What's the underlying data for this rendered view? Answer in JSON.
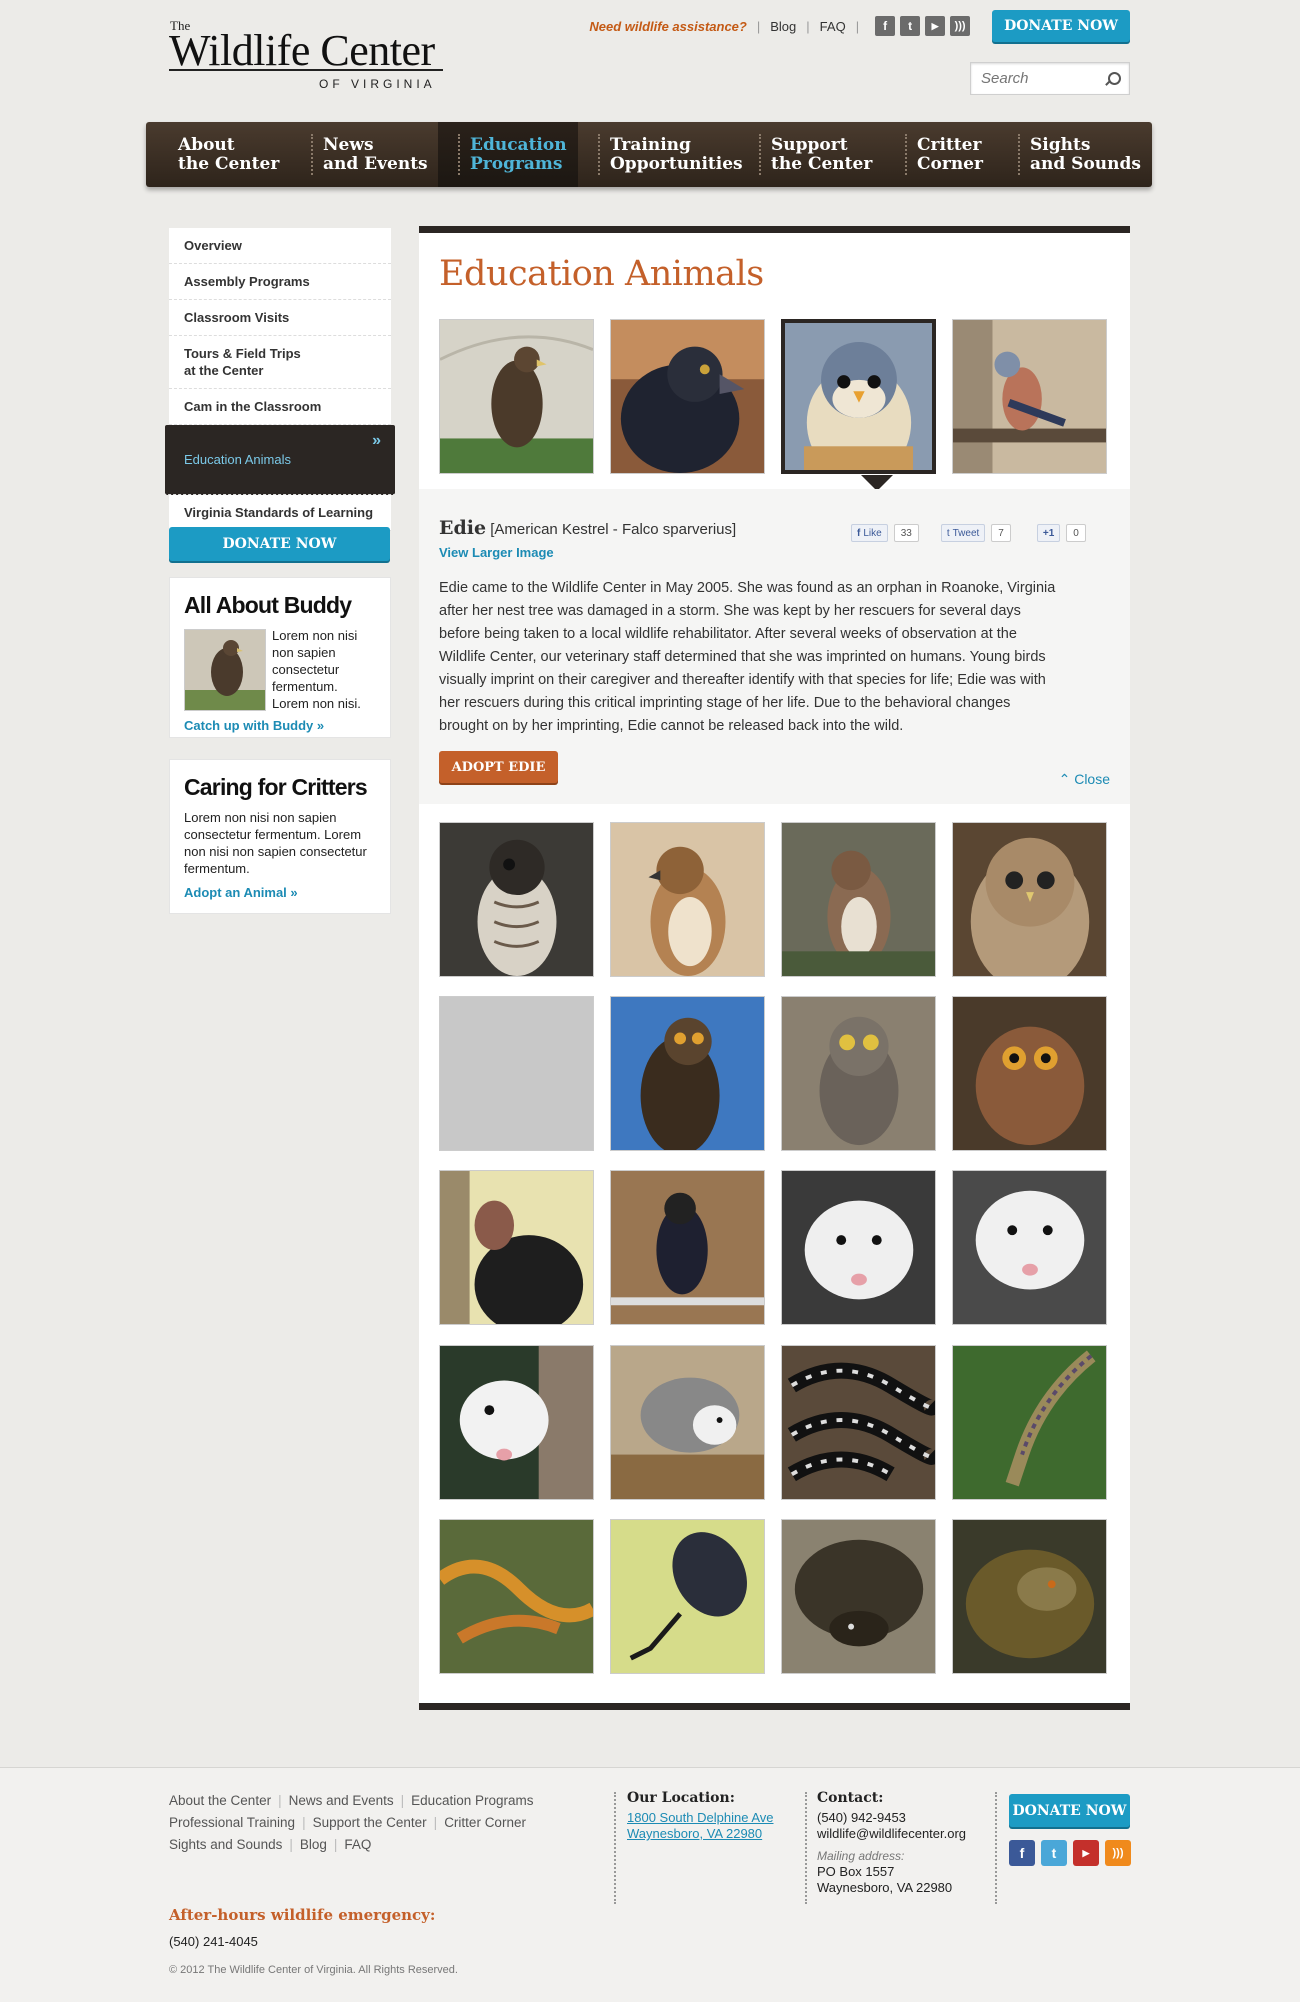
{
  "site": {
    "logo_the": "The",
    "logo_name": "Wildlife Center",
    "logo_sub": "OF VIRGINIA"
  },
  "topbar": {
    "assist": "Need wildlife assistance?",
    "blog": "Blog",
    "faq": "FAQ",
    "donate": "DONATE NOW"
  },
  "search": {
    "placeholder": "Search"
  },
  "nav": [
    "About\nthe Center",
    "News\nand Events",
    "Education\nPrograms",
    "Training\nOpportunities",
    "Support\nthe Center",
    "Critter\nCorner",
    "Sights\nand Sounds"
  ],
  "sidenav": [
    "Overview",
    "Assembly Programs",
    "Classroom Visits",
    "Tours & Field Trips\nat the Center",
    "Cam in the Classroom",
    "Education Animals",
    "Virginia Standards of Learning"
  ],
  "sidebar": {
    "donate": "DONATE NOW",
    "buddy_title": "All About Buddy",
    "buddy_text": "Lorem non nisi non sapien consectetur fermentum. Lorem non nisi.",
    "buddy_link": "Catch up with Buddy »",
    "critters_title": "Caring for Critters",
    "critters_text": "Lorem non nisi non sapien consectetur fermentum. Lorem non nisi non sapien consectetur fermentum.",
    "critters_link": "Adopt an Animal »"
  },
  "content": {
    "title": "Education Animals",
    "animal_name": "Edie",
    "animal_species": "[American Kestrel - Falco sparverius]",
    "view_larger": "View Larger Image",
    "like": "Like",
    "like_count": "33",
    "tweet": "Tweet",
    "tweet_count": "7",
    "plus": "+1",
    "plus_count": "0",
    "description": "Edie came to the Wildlife Center in May 2005. She was found as an orphan in Roanoke, Virginia after her nest tree was damaged in a storm. She was kept by her rescuers for several days before being taken to a local wildlife rehabilitator. After several weeks of observation at the Wildlife Center, our veterinary staff determined that she was imprinted on humans. Young birds visually imprint on their caregiver and thereafter identify with that species for life; Edie was with her rescuers during this critical imprinting stage of her life. Due to the behavioral changes brought on by her imprinting, Edie cannot be released back into the wild.",
    "adopt": "ADOPT EDIE",
    "close": "Close"
  },
  "footer": {
    "links": [
      "About the Center",
      "News and Events",
      "Education Programs",
      "Professional Training",
      "Support the Center",
      "Critter Corner",
      "Sights and Sounds",
      "Blog",
      "FAQ"
    ],
    "location_title": "Our Location:",
    "location_line1": "1800 South Delphine Ave",
    "location_line2": "Waynesboro, VA 22980",
    "contact_title": "Contact:",
    "phone": "(540) 942-9453",
    "email": "wildlife@wildlifecenter.org",
    "mailing_label": "Mailing address:",
    "mailing_line1": "PO Box 1557",
    "mailing_line2": "Waynesboro, VA 22980",
    "donate": "DONATE NOW",
    "emergency_title": "After-hours wildlife emergency:",
    "emergency_phone": "(540) 241-4045",
    "copyright": "© 2012 The Wildlife Center of Virginia. All Rights Reserved."
  },
  "colors": {
    "accent_blue": "#1c9bc4",
    "accent_orange": "#c4602a",
    "dark_brown": "#2b2623"
  }
}
